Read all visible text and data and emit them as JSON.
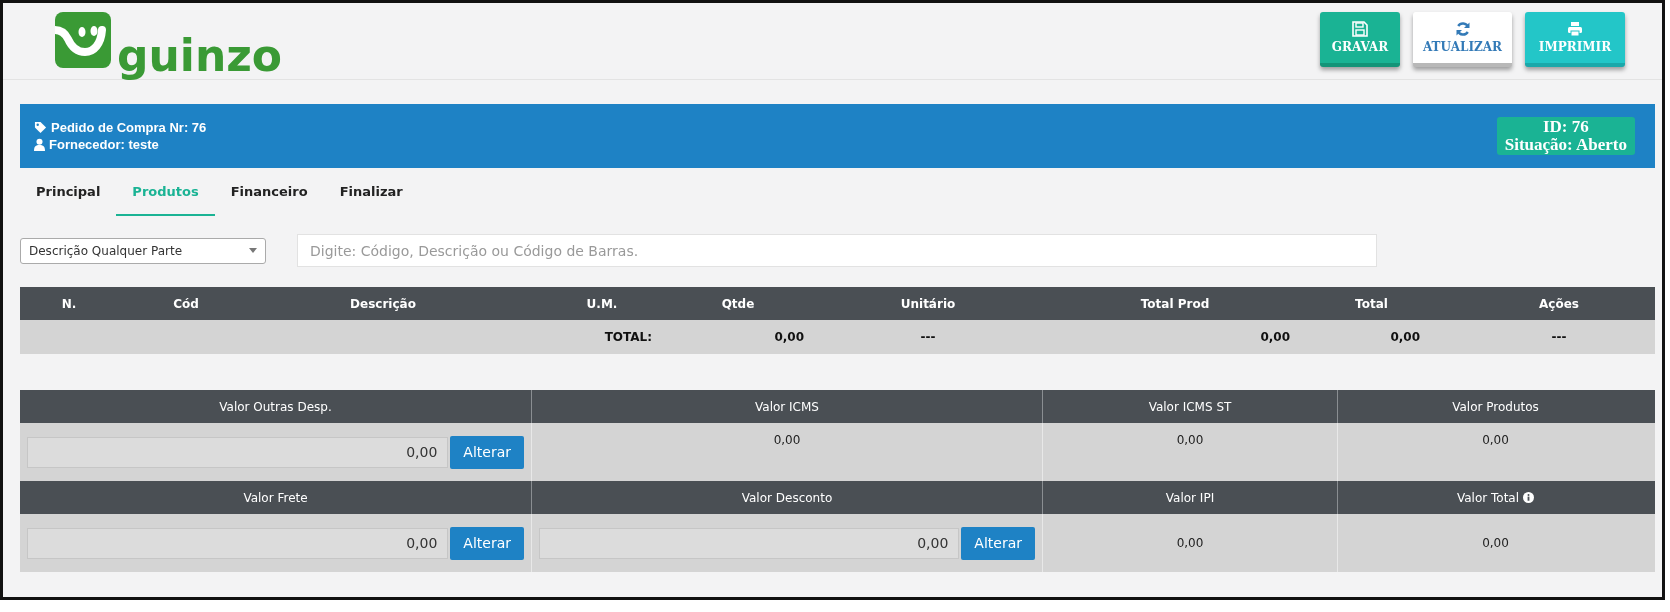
{
  "header": {
    "logo_text": "guinzo",
    "buttons": [
      {
        "label": "GRAVAR",
        "kind": "save"
      },
      {
        "label": "ATUALIZAR",
        "kind": "refresh"
      },
      {
        "label": "IMPRIMIR",
        "kind": "print"
      }
    ]
  },
  "order_bar": {
    "title": "Pedido de Compra Nr: 76",
    "supplier": "Fornecedor: teste",
    "badge_lines": [
      "ID: 76",
      "Situação: Aberto"
    ]
  },
  "tabs": [
    {
      "label": "Principal",
      "selected": false
    },
    {
      "label": "Produtos",
      "selected": true
    },
    {
      "label": "Financeiro",
      "selected": false
    },
    {
      "label": "Finalizar",
      "selected": false
    }
  ],
  "filter": {
    "search_mode": "Descrição Qualquer Parte",
    "placeholder": "Digite: Código, Descrição ou Código de Barras."
  },
  "table": {
    "columns": [
      "N.",
      "Cód",
      "Descrição",
      "U.M.",
      "Qtde",
      "Unitário",
      "Total Prod",
      "Total",
      "Ações"
    ],
    "total_row": {
      "label": "TOTAL:",
      "qtde": "0,00",
      "unitario": "---",
      "total_prod": "0,00",
      "total": "0,00",
      "acoes": "---"
    }
  },
  "summary": [
    [
      {
        "label": "Valor Outras Desp.",
        "kind": "input",
        "value": "0,00",
        "button": "Alterar",
        "info": false
      },
      {
        "label": "Valor ICMS",
        "kind": "text",
        "value": "0,00",
        "info": false
      },
      {
        "label": "Valor ICMS ST",
        "kind": "text",
        "value": "0,00",
        "info": false
      },
      {
        "label": "Valor Produtos",
        "kind": "text",
        "value": "0,00",
        "info": false
      }
    ],
    [
      {
        "label": "Valor Frete",
        "kind": "input",
        "value": "0,00",
        "button": "Alterar",
        "info": false
      },
      {
        "label": "Valor Desconto",
        "kind": "input",
        "value": "0,00",
        "button": "Alterar",
        "info": false
      },
      {
        "label": "Valor IPI",
        "kind": "text",
        "value": "0,00",
        "info": false
      },
      {
        "label": "Valor Total",
        "kind": "text",
        "value": "0,00",
        "info": true
      }
    ]
  ]
}
